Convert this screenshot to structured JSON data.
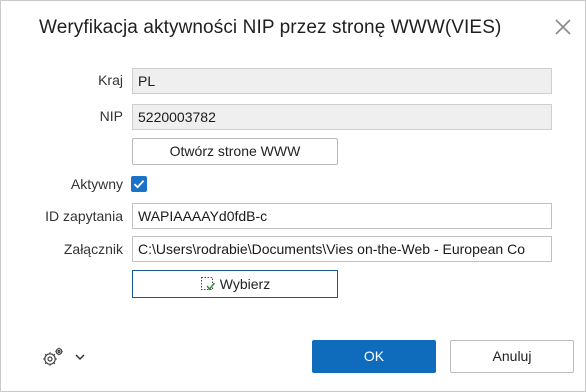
{
  "dialog": {
    "title": "Weryfikacja aktywności NIP przez stronę WWW(VIES)",
    "close_icon": "close-icon"
  },
  "form": {
    "country_label": "Kraj",
    "country_value": "PL",
    "nip_label": "NIP",
    "nip_value": "5220003782",
    "open_www_label": "Otwórz strone WWW",
    "active_label": "Aktywny",
    "active_checked": true,
    "request_id_label": "ID zapytania",
    "request_id_value": "WAPIAAAAYd0fdB-c",
    "attachment_label": "Załącznik",
    "attachment_value": "C:\\Users\\rodrabie\\Documents\\Vies on-the-Web - European Co",
    "choose_label": "Wybierz",
    "choose_icon": "select-file-icon"
  },
  "footer": {
    "settings_icon": "gear-icon",
    "dropdown_icon": "chevron-down-icon",
    "ok_label": "OK",
    "cancel_label": "Anuluj"
  },
  "colors": {
    "primary": "#0f6cbd",
    "checkbox": "#1a73c9",
    "readonly_bg": "#efefef"
  }
}
